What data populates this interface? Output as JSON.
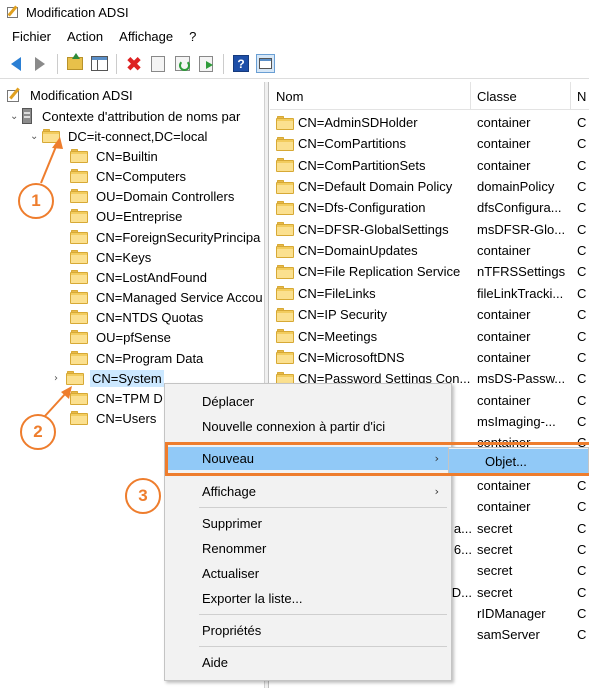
{
  "window": {
    "title": "Modification ADSI"
  },
  "menubar": {
    "items": [
      "Fichier",
      "Action",
      "Affichage",
      "?"
    ]
  },
  "toolbar": {
    "icons": [
      "back-arrow-icon",
      "forward-arrow-icon",
      "folder-up-icon",
      "show-hide-tree-icon",
      "delete-icon",
      "properties-icon",
      "refresh-icon",
      "export-list-icon",
      "help-icon",
      "panel-toggle-icon"
    ]
  },
  "tree": {
    "root": "Modification ADSI",
    "context": "Contexte d'attribution de noms par",
    "domain": "DC=it-connect,DC=local",
    "children": [
      "CN=Builtin",
      "CN=Computers",
      "OU=Domain Controllers",
      "OU=Entreprise",
      "CN=ForeignSecurityPrincipa",
      "CN=Keys",
      "CN=LostAndFound",
      "CN=Managed Service Accou",
      "CN=NTDS Quotas",
      "OU=pfSense",
      "CN=Program Data",
      "CN=System",
      "CN=TPM D",
      "CN=Users"
    ]
  },
  "list": {
    "columns": [
      "Nom",
      "Classe",
      "N"
    ],
    "rows": [
      {
        "name": "CN=AdminSDHolder",
        "cls": "container",
        "extra": "C"
      },
      {
        "name": "CN=ComPartitions",
        "cls": "container",
        "extra": "C"
      },
      {
        "name": "CN=ComPartitionSets",
        "cls": "container",
        "extra": "C"
      },
      {
        "name": "CN=Default Domain Policy",
        "cls": "domainPolicy",
        "extra": "C"
      },
      {
        "name": "CN=Dfs-Configuration",
        "cls": "dfsConfigura...",
        "extra": "C"
      },
      {
        "name": "CN=DFSR-GlobalSettings",
        "cls": "msDFSR-Glo...",
        "extra": "C"
      },
      {
        "name": "CN=DomainUpdates",
        "cls": "container",
        "extra": "C"
      },
      {
        "name": "CN=File Replication Service",
        "cls": "nTFRSSettings",
        "extra": "C"
      },
      {
        "name": "CN=FileLinks",
        "cls": "fileLinkTracki...",
        "extra": "C"
      },
      {
        "name": "CN=IP Security",
        "cls": "container",
        "extra": "C"
      },
      {
        "name": "CN=Meetings",
        "cls": "container",
        "extra": "C"
      },
      {
        "name": "CN=MicrosoftDNS",
        "cls": "container",
        "extra": "C"
      },
      {
        "name": "CN=Password Settings Con...",
        "cls": "msDS-Passw...",
        "extra": "C"
      },
      {
        "name": "",
        "cls": "container",
        "extra": "C"
      },
      {
        "name": "",
        "cls": "msImaging-...",
        "extra": "C"
      },
      {
        "name": "",
        "cls": "container",
        "extra": "C"
      },
      {
        "name": "",
        "cls": "",
        "extra": "C"
      },
      {
        "name": "",
        "cls": "container",
        "extra": "C"
      },
      {
        "name": "",
        "cls": "container",
        "extra": "C"
      },
      {
        "name": "a...",
        "cls": "secret",
        "extra": "C"
      },
      {
        "name": "6...",
        "cls": "secret",
        "extra": "C"
      },
      {
        "name": "",
        "cls": "secret",
        "extra": "C"
      },
      {
        "name": "D...",
        "cls": "secret",
        "extra": "C"
      },
      {
        "name": "",
        "cls": "rIDManager",
        "extra": "C"
      },
      {
        "name": "",
        "cls": "samServer",
        "extra": "C"
      }
    ]
  },
  "context_menu": {
    "items": {
      "move": "Déplacer",
      "new_connection": "Nouvelle connexion à partir d'ici",
      "new": "Nouveau",
      "view": "Affichage",
      "delete": "Supprimer",
      "rename": "Renommer",
      "refresh": "Actualiser",
      "export": "Exporter la liste...",
      "properties": "Propriétés",
      "help": "Aide"
    },
    "submenu_item": "Objet..."
  },
  "callouts": [
    "1",
    "2",
    "3"
  ],
  "colors": {
    "accent_orange": "#ee7d2d",
    "highlight_blue": "#91c9f7",
    "selection": "#cce8ff"
  }
}
